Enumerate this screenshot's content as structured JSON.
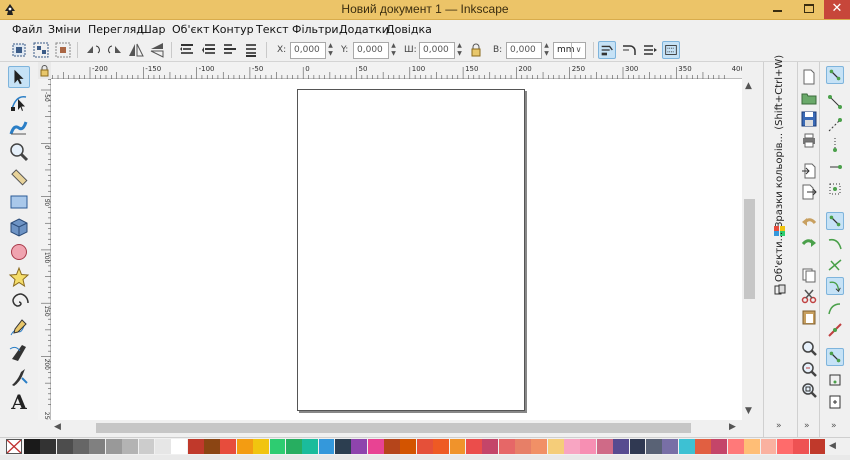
{
  "window": {
    "title": "Новий документ 1 — Inkscape",
    "close_glyph": "✕",
    "title_bar_color": "#ecc468"
  },
  "menu": [
    {
      "label": "Файл"
    },
    {
      "label": "Зміни"
    },
    {
      "label": "Перегляд"
    },
    {
      "label": "Шар"
    },
    {
      "label": "Об'єкт"
    },
    {
      "label": "Контур"
    },
    {
      "label": "Текст"
    },
    {
      "label": "Фільтри"
    },
    {
      "label": "Додатки"
    },
    {
      "label": "Довідка"
    }
  ],
  "select_toolbar": {
    "x": {
      "label": "X:",
      "value": "0,000"
    },
    "y": {
      "label": "Y:",
      "value": "0,000"
    },
    "w": {
      "label": "Ш:",
      "value": "0,000"
    },
    "h": {
      "label": "В:",
      "value": "0,000"
    },
    "unit": "mm",
    "dropdown_glyph": "∨",
    "spin_glyphs": [
      "▲",
      "▼"
    ]
  },
  "ruler": {
    "top_labels": [
      "-200",
      "-150",
      "-100",
      "-50",
      "0",
      "50",
      "100",
      "150",
      "200",
      "250",
      "300",
      "350",
      "400"
    ],
    "left_labels": [
      "-50",
      "0",
      "50",
      "100",
      "150",
      "200",
      "250"
    ]
  },
  "docks": {
    "swatches_label": "Зразки кольорів... (Shift+Ctrl+W)",
    "objects_label": "Об'єкти..."
  },
  "tools": [
    {
      "icon": "selector-arrow-icon",
      "active": true
    },
    {
      "icon": "node-editor-icon",
      "active": false
    },
    {
      "icon": "tweak-icon",
      "active": false
    },
    {
      "icon": "zoom-icon",
      "active": false
    },
    {
      "icon": "measure-icon",
      "active": false
    },
    {
      "icon": "rectangle-icon",
      "active": false
    },
    {
      "icon": "box-3d-icon",
      "active": false
    },
    {
      "icon": "ellipse-icon",
      "active": false
    },
    {
      "icon": "star-icon",
      "active": false
    },
    {
      "icon": "spiral-icon",
      "active": false
    },
    {
      "icon": "pencil-icon",
      "active": false
    },
    {
      "icon": "pen-icon",
      "active": false
    },
    {
      "icon": "calligraphy-icon",
      "active": false
    },
    {
      "icon": "text-icon",
      "active": false,
      "glyph": "A"
    }
  ],
  "palette_colors": [
    "#1a1a1a",
    "#333333",
    "#4d4d4d",
    "#666666",
    "#808080",
    "#999999",
    "#b3b3b3",
    "#cccccc",
    "#e6e6e6",
    "#ffffff",
    "#c0392b",
    "#8b4513",
    "#e74c3c",
    "#f39c12",
    "#f1c40f",
    "#2ecc71",
    "#27ae60",
    "#1abc9c",
    "#3498db",
    "#2c3e50",
    "#8e44ad",
    "#e84393",
    "#b5451b",
    "#d35400",
    "#e55039",
    "#ee5a24",
    "#f0932b",
    "#eb4d4b",
    "#c44569",
    "#e66767",
    "#e77f67",
    "#f19066",
    "#f5cd79",
    "#f8a5c2",
    "#f78fb3",
    "#cf6a87",
    "#574b90",
    "#303952",
    "#596275",
    "#786fa6",
    "#3dc1d3",
    "#e15f41",
    "#c44569",
    "#ff7979",
    "#ffbe76",
    "#fab1a0",
    "#ff6b6b",
    "#ee5253",
    "#c0392b"
  ],
  "accent_color": "#c6e2f6",
  "close_color": "#c7463a"
}
